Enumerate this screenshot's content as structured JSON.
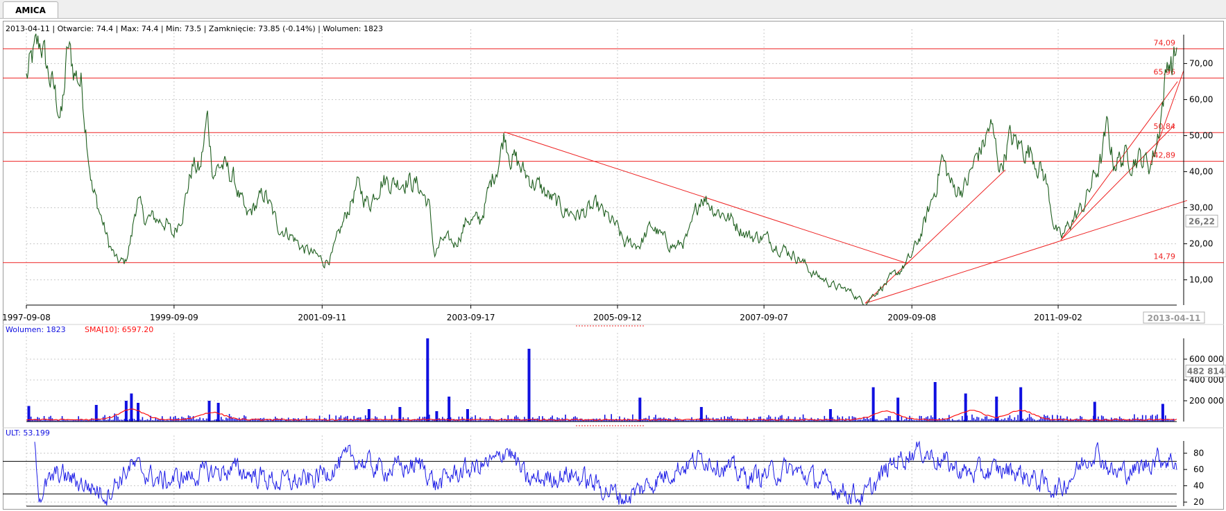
{
  "window": {
    "tab_label": "AMICA"
  },
  "colors": {
    "price": "#1e5e1e",
    "level": "#ee2222",
    "volume": "#1010e0",
    "sma": "#ff1010",
    "ult": "#1a1ae6",
    "grid": "#c8c8c8",
    "axis": "#000000"
  },
  "header": {
    "info": "2013-04-11 | Otwarcie: 74.4 | Max: 74.4 | Min: 73.5 | Zamknięcie: 73.85 (-0.14%)  | Wolumen: 1823",
    "volume_label": "Wolumen: 1823",
    "sma_label": "SMA[10]: 6597.20",
    "ult_label": "ULT: 53.199"
  },
  "chart_data": [
    {
      "type": "line",
      "name": "price",
      "x_ticks": [
        "1997-09-08",
        "1999-09-09",
        "2001-09-11",
        "2003-09-17",
        "2005-09-12",
        "2007-09-07",
        "2009-09-08",
        "2011-09-02"
      ],
      "x_current": "2013-04-11",
      "y_ticks": [
        "10,00",
        "20,00",
        "30,00",
        "40,00",
        "50,00",
        "60,00",
        "70,00"
      ],
      "y_current": "26,22",
      "ylim": [
        3,
        78
      ],
      "levels": [
        {
          "value": 74.09,
          "label": "74,09"
        },
        {
          "value": 65.96,
          "label": "65,96"
        },
        {
          "value": 50.84,
          "label": "50,84"
        },
        {
          "value": 42.89,
          "label": "42,89"
        },
        {
          "value": 14.79,
          "label": "14,79"
        }
      ],
      "trendlines": [
        {
          "from": [
            "2004-03-01",
            51.0
          ],
          "to": [
            "2009-08-20",
            14.5
          ]
        },
        {
          "from": [
            "2009-01-20",
            3.5
          ],
          "to": [
            "2013-06-01",
            32.0
          ]
        },
        {
          "from": [
            "2009-01-20",
            3.5
          ],
          "to": [
            "2010-12-15",
            40.5
          ]
        },
        {
          "from": [
            "2011-09-15",
            21.0
          ],
          "to": [
            "2013-04-01",
            53.0
          ]
        },
        {
          "from": [
            "2011-09-15",
            21.0
          ],
          "to": [
            "2013-04-15",
            65.0
          ]
        },
        {
          "from": [
            "2012-12-01",
            42.0
          ],
          "to": [
            "2013-05-15",
            68.0
          ]
        }
      ],
      "points": [
        [
          "1997-09-08",
          66
        ],
        [
          "1997-10-15",
          72
        ],
        [
          "1997-11-20",
          76
        ],
        [
          "1997-12-20",
          68
        ],
        [
          "1998-01-25",
          62
        ],
        [
          "1998-03-01",
          55
        ],
        [
          "1998-04-01",
          74
        ],
        [
          "1998-05-01",
          68
        ],
        [
          "1998-06-05",
          65
        ],
        [
          "1998-07-01",
          52
        ],
        [
          "1998-08-01",
          35
        ],
        [
          "1998-09-10",
          28
        ],
        [
          "1998-10-20",
          20
        ],
        [
          "1998-12-01",
          15
        ],
        [
          "1999-01-10",
          14.8
        ],
        [
          "1999-02-10",
          22
        ],
        [
          "1999-03-10",
          33
        ],
        [
          "1999-04-10",
          27
        ],
        [
          "1999-06-01",
          27
        ],
        [
          "1999-08-01",
          26
        ],
        [
          "1999-09-01",
          22
        ],
        [
          "1999-10-20",
          29
        ],
        [
          "1999-12-10",
          42
        ],
        [
          "2000-01-15",
          40
        ],
        [
          "2000-02-20",
          55
        ],
        [
          "2000-03-20",
          40
        ],
        [
          "2000-05-01",
          42
        ],
        [
          "2000-07-01",
          38
        ],
        [
          "2000-09-01",
          27
        ],
        [
          "2000-12-01",
          34
        ],
        [
          "2001-02-01",
          25
        ],
        [
          "2001-04-01",
          23
        ],
        [
          "2001-06-01",
          19
        ],
        [
          "2001-08-01",
          17
        ],
        [
          "2001-09-20",
          15
        ],
        [
          "2001-11-01",
          17
        ],
        [
          "2002-01-01",
          27
        ],
        [
          "2002-03-01",
          36
        ],
        [
          "2002-05-01",
          31
        ],
        [
          "2002-07-01",
          38
        ],
        [
          "2002-09-01",
          37
        ],
        [
          "2002-11-01",
          38
        ],
        [
          "2003-01-01",
          36
        ],
        [
          "2003-02-20",
          31
        ],
        [
          "2003-03-20",
          17
        ],
        [
          "2003-05-01",
          21
        ],
        [
          "2003-07-01",
          20
        ],
        [
          "2003-09-01",
          27
        ],
        [
          "2003-11-01",
          26
        ],
        [
          "2004-01-01",
          38
        ],
        [
          "2004-02-10",
          45
        ],
        [
          "2004-03-01",
          51
        ],
        [
          "2004-04-01",
          45
        ],
        [
          "2004-06-01",
          40
        ],
        [
          "2004-09-01",
          35
        ],
        [
          "2004-12-01",
          30
        ],
        [
          "2005-03-01",
          28
        ],
        [
          "2005-06-01",
          30
        ],
        [
          "2005-09-01",
          25
        ],
        [
          "2005-10-15",
          20
        ],
        [
          "2006-01-01",
          20
        ],
        [
          "2006-03-01",
          25
        ],
        [
          "2006-05-01",
          21
        ],
        [
          "2006-07-01",
          19
        ],
        [
          "2006-09-01",
          22
        ],
        [
          "2006-11-01",
          34
        ],
        [
          "2007-01-01",
          30
        ],
        [
          "2007-03-01",
          28
        ],
        [
          "2007-05-01",
          25
        ],
        [
          "2007-07-01",
          22
        ],
        [
          "2007-09-01",
          22
        ],
        [
          "2007-11-01",
          20
        ],
        [
          "2008-01-01",
          18
        ],
        [
          "2008-03-01",
          16
        ],
        [
          "2008-05-01",
          12
        ],
        [
          "2008-07-01",
          10
        ],
        [
          "2008-09-01",
          8
        ],
        [
          "2008-11-01",
          7
        ],
        [
          "2009-01-20",
          3.5
        ],
        [
          "2009-03-01",
          6
        ],
        [
          "2009-05-01",
          9
        ],
        [
          "2009-07-01",
          12
        ],
        [
          "2009-09-01",
          16
        ],
        [
          "2009-11-01",
          24
        ],
        [
          "2010-01-01",
          35
        ],
        [
          "2010-02-01",
          44
        ],
        [
          "2010-04-01",
          35
        ],
        [
          "2010-06-01",
          36
        ],
        [
          "2010-08-01",
          45
        ],
        [
          "2010-09-01",
          48
        ],
        [
          "2010-10-01",
          53
        ],
        [
          "2010-11-20",
          41
        ],
        [
          "2011-01-01",
          49
        ],
        [
          "2011-03-01",
          47
        ],
        [
          "2011-05-01",
          45
        ],
        [
          "2011-07-01",
          38
        ],
        [
          "2011-08-15",
          25
        ],
        [
          "2011-09-15",
          21
        ],
        [
          "2011-11-01",
          26
        ],
        [
          "2012-01-01",
          30
        ],
        [
          "2012-03-01",
          39
        ],
        [
          "2012-04-01",
          43
        ],
        [
          "2012-05-01",
          52
        ],
        [
          "2012-06-01",
          43
        ],
        [
          "2012-08-01",
          44
        ],
        [
          "2012-10-01",
          44
        ],
        [
          "2012-12-01",
          42
        ],
        [
          "2013-01-01",
          48
        ],
        [
          "2013-02-01",
          60
        ],
        [
          "2013-03-01",
          72
        ],
        [
          "2013-03-20",
          70
        ],
        [
          "2013-04-11",
          73.85
        ]
      ]
    },
    {
      "type": "bar",
      "name": "volume",
      "y_ticks": [
        "200 000",
        "400 000",
        "600 000"
      ],
      "y_current": "482 814",
      "ylim": [
        0,
        800000
      ],
      "spikes": [
        [
          "1997-09-20",
          150000
        ],
        [
          "1998-08-20",
          160000
        ],
        [
          "1999-01-15",
          200000
        ],
        [
          "1999-02-10",
          270000
        ],
        [
          "1999-03-15",
          180000
        ],
        [
          "2000-03-01",
          200000
        ],
        [
          "2000-04-15",
          180000
        ],
        [
          "2002-05-01",
          120000
        ],
        [
          "2002-10-01",
          140000
        ],
        [
          "2003-02-15",
          800000
        ],
        [
          "2003-04-01",
          100000
        ],
        [
          "2003-06-01",
          240000
        ],
        [
          "2003-09-01",
          120000
        ],
        [
          "2004-07-01",
          700000
        ],
        [
          "2006-01-01",
          230000
        ],
        [
          "2006-11-01",
          140000
        ],
        [
          "2008-08-01",
          120000
        ],
        [
          "2009-03-01",
          330000
        ],
        [
          "2009-07-01",
          230000
        ],
        [
          "2010-01-01",
          380000
        ],
        [
          "2010-06-01",
          270000
        ],
        [
          "2010-11-01",
          240000
        ],
        [
          "2011-03-01",
          330000
        ],
        [
          "2012-03-01",
          190000
        ],
        [
          "2013-02-01",
          170000
        ]
      ],
      "sma_bumps": [
        [
          "1999-02-10",
          100000
        ],
        [
          "2000-03-15",
          70000
        ],
        [
          "2009-05-01",
          80000
        ],
        [
          "2010-07-01",
          90000
        ],
        [
          "2011-03-01",
          90000
        ]
      ]
    },
    {
      "type": "line",
      "name": "ULT",
      "y_ticks": [
        "20",
        "40",
        "60",
        "80"
      ],
      "ylim": [
        15,
        95
      ],
      "thresholds": [
        70,
        30
      ],
      "points": [
        [
          "1997-09-08",
          89
        ],
        [
          "1997-10-01",
          30
        ],
        [
          "1998-01-01",
          55
        ],
        [
          "1998-06-01",
          40
        ],
        [
          "1998-09-01",
          30
        ],
        [
          "1999-01-01",
          65
        ],
        [
          "1999-06-01",
          45
        ],
        [
          "2000-01-01",
          55
        ],
        [
          "2000-06-01",
          60
        ],
        [
          "2001-01-01",
          45
        ],
        [
          "2001-06-01",
          45
        ],
        [
          "2002-01-01",
          75
        ],
        [
          "2002-06-01",
          60
        ],
        [
          "2003-01-01",
          65
        ],
        [
          "2003-03-01",
          40
        ],
        [
          "2003-06-01",
          55
        ],
        [
          "2004-01-01",
          70
        ],
        [
          "2004-02-15",
          89
        ],
        [
          "2004-06-01",
          45
        ],
        [
          "2005-01-01",
          55
        ],
        [
          "2005-10-01",
          25
        ],
        [
          "2006-06-01",
          60
        ],
        [
          "2006-11-01",
          75
        ],
        [
          "2007-06-01",
          50
        ],
        [
          "2008-01-01",
          60
        ],
        [
          "2008-06-01",
          45
        ],
        [
          "2009-01-01",
          25
        ],
        [
          "2009-06-01",
          70
        ],
        [
          "2009-10-01",
          85
        ],
        [
          "2010-06-01",
          55
        ],
        [
          "2011-01-01",
          60
        ],
        [
          "2011-09-01",
          35
        ],
        [
          "2012-03-01",
          85
        ],
        [
          "2012-06-01",
          55
        ],
        [
          "2012-10-01",
          60
        ],
        [
          "2013-01-01",
          75
        ],
        [
          "2013-04-11",
          70
        ]
      ]
    }
  ]
}
